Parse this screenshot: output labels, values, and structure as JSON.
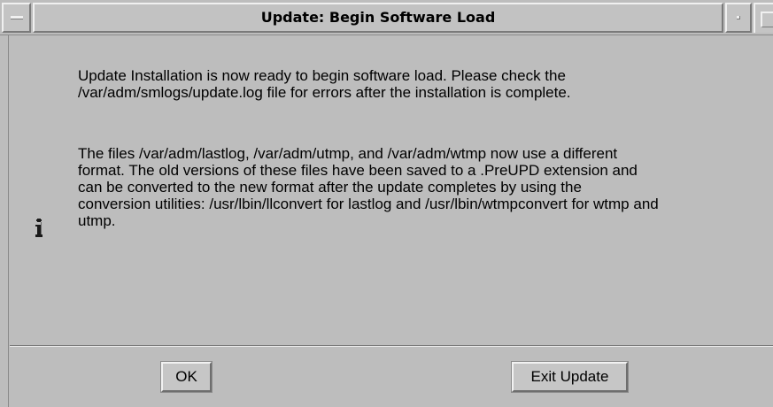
{
  "window": {
    "title": "Update: Begin Software Load"
  },
  "message": {
    "icon": "info-icon",
    "paragraph1": "Update Installation is now ready to begin software load. Please check the\n/var/adm/smlogs/update.log file for errors after the installation is complete.",
    "paragraph2": "The files /var/adm/lastlog, /var/adm/utmp, and /var/adm/wtmp now use a different\nformat. The old versions of these files have been saved to a .PreUPD extension and\ncan be converted to the new format after the update completes by using the\nconversion utilities: /usr/lbin/llconvert for lastlog and /usr/lbin/wtmpconvert for wtmp and\nutmp."
  },
  "buttons": {
    "ok_label": "OK",
    "exit_label": "Exit Update"
  },
  "colors": {
    "background": "#bdbdbd",
    "highlight": "#f0f0f0",
    "shadow": "#7a7a7a"
  }
}
